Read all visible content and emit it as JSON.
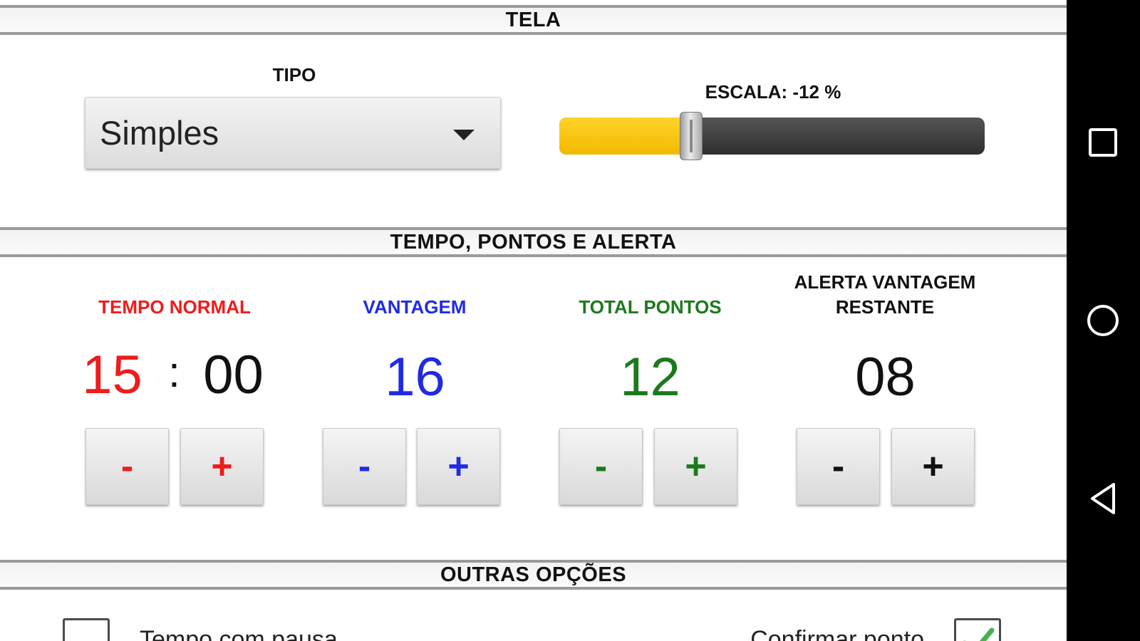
{
  "sections": {
    "tela": "TELA",
    "tempo": "TEMPO, PONTOS E ALERTA",
    "outras": "OUTRAS OPÇÕES"
  },
  "tipo": {
    "label": "TIPO",
    "value": "Simples"
  },
  "escala": {
    "label": "ESCALA: -12 %",
    "level_fraction": 0.31
  },
  "columns": {
    "tempo_normal": {
      "label": "TEMPO NORMAL",
      "minutes": "15",
      "separator": ":",
      "seconds": "00",
      "minus": "-",
      "plus": "+",
      "color": "#ee1c1c"
    },
    "vantagem": {
      "label": "VANTAGEM",
      "value": "16",
      "minus": "-",
      "plus": "+",
      "color": "#1f2be3"
    },
    "total_pontos": {
      "label": "TOTAL PONTOS",
      "value": "12",
      "minus": "-",
      "plus": "+",
      "color": "#1c7a1c"
    },
    "alerta": {
      "label_line1": "ALERTA VANTAGEM",
      "label_line2": "RESTANTE",
      "value": "08",
      "minus": "-",
      "plus": "+",
      "color": "#111111"
    }
  },
  "options": {
    "tempo_com_pausa": {
      "label": "Tempo com pausa",
      "checked": false
    },
    "confirmar_ponto": {
      "label": "Confirmar ponto",
      "checked": true
    }
  },
  "navigation": {
    "icons": [
      "recents-square-icon",
      "home-circle-icon",
      "back-triangle-icon"
    ]
  }
}
